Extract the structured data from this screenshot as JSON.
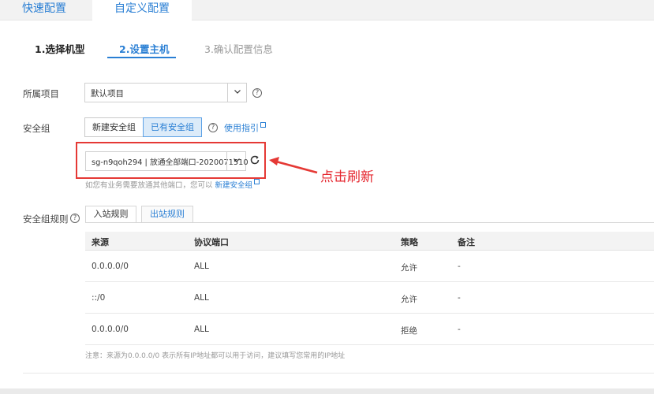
{
  "top_tabs": [
    {
      "label": "快速配置",
      "active": false
    },
    {
      "label": "自定义配置",
      "active": true
    }
  ],
  "steps": [
    {
      "label": "1.选择机型",
      "state": "done"
    },
    {
      "label": "2.设置主机",
      "state": "current"
    },
    {
      "label": "3.确认配置信息",
      "state": "pending"
    }
  ],
  "project": {
    "label": "所属项目",
    "value": "默认项目"
  },
  "security_group": {
    "label": "安全组",
    "buttons": [
      "新建安全组",
      "已有安全组"
    ],
    "active_button": "已有安全组",
    "guide_link": "使用指引",
    "selected": "sg-n9qoh294 | 放通全部端口-2020071510",
    "hint_prefix": "如您有业务需要放通其他端口，您可以",
    "hint_link": "新建安全组"
  },
  "annotation": {
    "text": "点击刷新",
    "color": "#e5262e"
  },
  "rules": {
    "label": "安全组规则",
    "tabs": [
      "入站规则",
      "出站规则"
    ],
    "active_tab": "入站规则",
    "columns": [
      "来源",
      "协议端口",
      "策略",
      "备注"
    ],
    "rows": [
      [
        "0.0.0.0/0",
        "ALL",
        "允许",
        "-"
      ],
      [
        "::/0",
        "ALL",
        "允许",
        "-"
      ],
      [
        "0.0.0.0/0",
        "ALL",
        "拒绝",
        "-"
      ]
    ],
    "note": "注意：来源为0.0.0.0/0 表示所有IP地址都可以用于访问，建议填写您常用的IP地址"
  },
  "colors": {
    "accent": "#2a7fd4",
    "highlight": "#e53935"
  },
  "icons": {
    "help": "help-circle-icon",
    "dropdown": "chevron-down-icon",
    "refresh": "refresh-icon",
    "external": "external-link-icon"
  }
}
